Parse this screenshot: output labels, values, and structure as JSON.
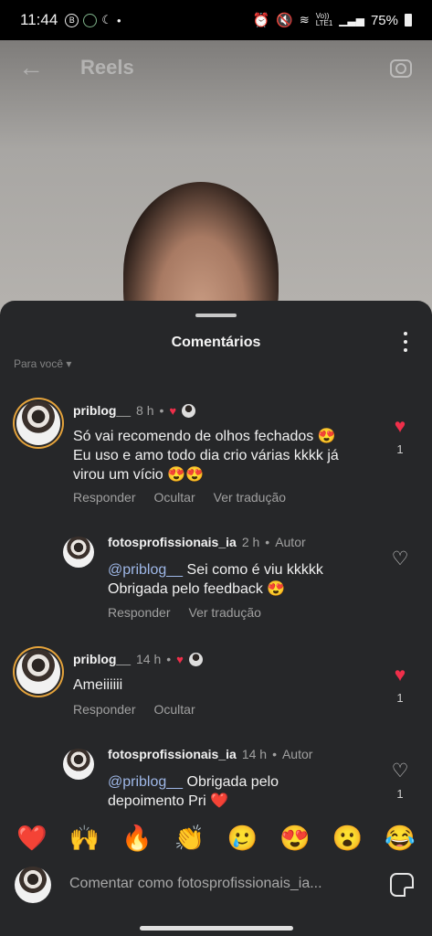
{
  "status": {
    "time": "11:44",
    "battery": "75%",
    "network": "Vo))\nLTE1"
  },
  "header": {
    "title": "Reels"
  },
  "sheet": {
    "title": "Comentários",
    "sort_label": "Para você"
  },
  "comments": [
    {
      "user": "priblog__",
      "time": "8 h",
      "line1": "Só vai recomendo de olhos fechados 😍",
      "line2": "Eu uso e amo todo dia crio várias kkkk já",
      "line3": "virou um vício 😍😍",
      "actions": [
        "Responder",
        "Ocultar",
        "Ver tradução"
      ],
      "likes": "1",
      "liked": true
    },
    {
      "user": "fotosprofissionais_ia",
      "time": "2 h",
      "author": "Autor",
      "mention": "@priblog__",
      "line1": " Sei como é viu kkkkk",
      "line2": "Obrigada pelo feedback 😍",
      "actions": [
        "Responder",
        "Ver tradução"
      ]
    },
    {
      "user": "priblog__",
      "time": "14 h",
      "line1": "Ameiiiiii",
      "actions": [
        "Responder",
        "Ocultar"
      ],
      "likes": "1",
      "liked": true
    },
    {
      "user": "fotosprofissionais_ia",
      "time": "14 h",
      "author": "Autor",
      "mention": "@priblog__",
      "line1": " Obrigada pelo",
      "line2": "depoimento Pri ❤️",
      "likes": "1"
    }
  ],
  "emojis": [
    "❤️",
    "🙌",
    "🔥",
    "👏",
    "🥲",
    "😍",
    "😮",
    "😂"
  ],
  "input": {
    "placeholder": "Comentar como fotosprofissionais_ia..."
  },
  "colors": {
    "sheet_bg": "#262729",
    "like_red": "#ef2f4a",
    "mention_blue": "#9fb8e8"
  }
}
